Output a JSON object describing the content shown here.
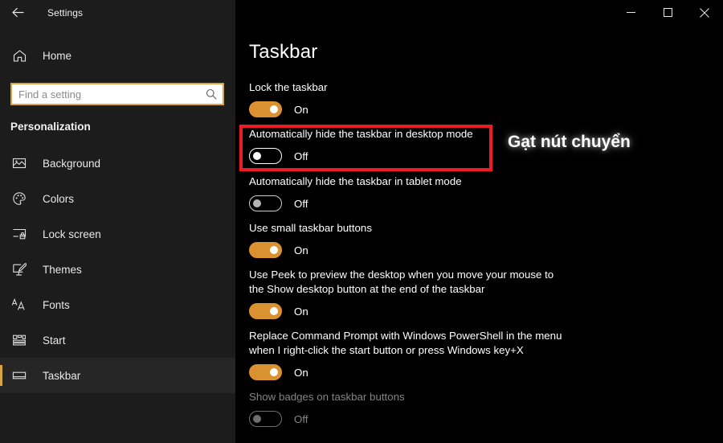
{
  "window": {
    "title": "Settings",
    "back_icon": "back-arrow-icon",
    "controls": {
      "minimize": "minimize-icon",
      "maximize": "maximize-icon",
      "close": "close-icon"
    }
  },
  "sidebar": {
    "home": {
      "label": "Home",
      "icon": "home-icon"
    },
    "search": {
      "value": "",
      "placeholder": "Find a setting",
      "icon": "search-icon"
    },
    "group_title": "Personalization",
    "items": [
      {
        "label": "Background",
        "icon": "picture-icon",
        "selected": false
      },
      {
        "label": "Colors",
        "icon": "palette-icon",
        "selected": false
      },
      {
        "label": "Lock screen",
        "icon": "lock-screen-icon",
        "selected": false
      },
      {
        "label": "Themes",
        "icon": "themes-brush-icon",
        "selected": false
      },
      {
        "label": "Fonts",
        "icon": "fonts-aa-icon",
        "selected": false
      },
      {
        "label": "Start",
        "icon": "start-menu-icon",
        "selected": false
      },
      {
        "label": "Taskbar",
        "icon": "taskbar-icon",
        "selected": true
      }
    ]
  },
  "main": {
    "page_title": "Taskbar",
    "settings": [
      {
        "caption": "Lock the taskbar",
        "state_label": "On",
        "toggle": "on",
        "disabled": false,
        "highlighted": false
      },
      {
        "caption": "Automatically hide the taskbar in desktop mode",
        "state_label": "Off",
        "toggle": "off",
        "disabled": false,
        "highlighted": true
      },
      {
        "caption": "Automatically hide the taskbar in tablet mode",
        "state_label": "Off",
        "toggle": "off-dim",
        "disabled": false,
        "highlighted": false
      },
      {
        "caption": "Use small taskbar buttons",
        "state_label": "On",
        "toggle": "on",
        "disabled": false,
        "highlighted": false
      },
      {
        "caption": "Use Peek to preview the desktop when you move your mouse to the Show desktop button at the end of the taskbar",
        "state_label": "On",
        "toggle": "on",
        "disabled": false,
        "highlighted": false
      },
      {
        "caption": "Replace Command Prompt with Windows PowerShell in the menu when I right-click the start button or press Windows key+X",
        "state_label": "On",
        "toggle": "on",
        "disabled": false,
        "highlighted": false
      },
      {
        "caption": "Show badges on taskbar buttons",
        "state_label": "Off",
        "toggle": "off-disabled",
        "disabled": true,
        "highlighted": false
      }
    ]
  },
  "annotation": {
    "text": "Gạt nút chuyển"
  },
  "colors": {
    "accent": "#d9922f",
    "search_border": "#d9a441",
    "highlight_box": "#ed1c24",
    "sidebar_bg": "#1c1c1c",
    "content_bg": "#000000"
  }
}
